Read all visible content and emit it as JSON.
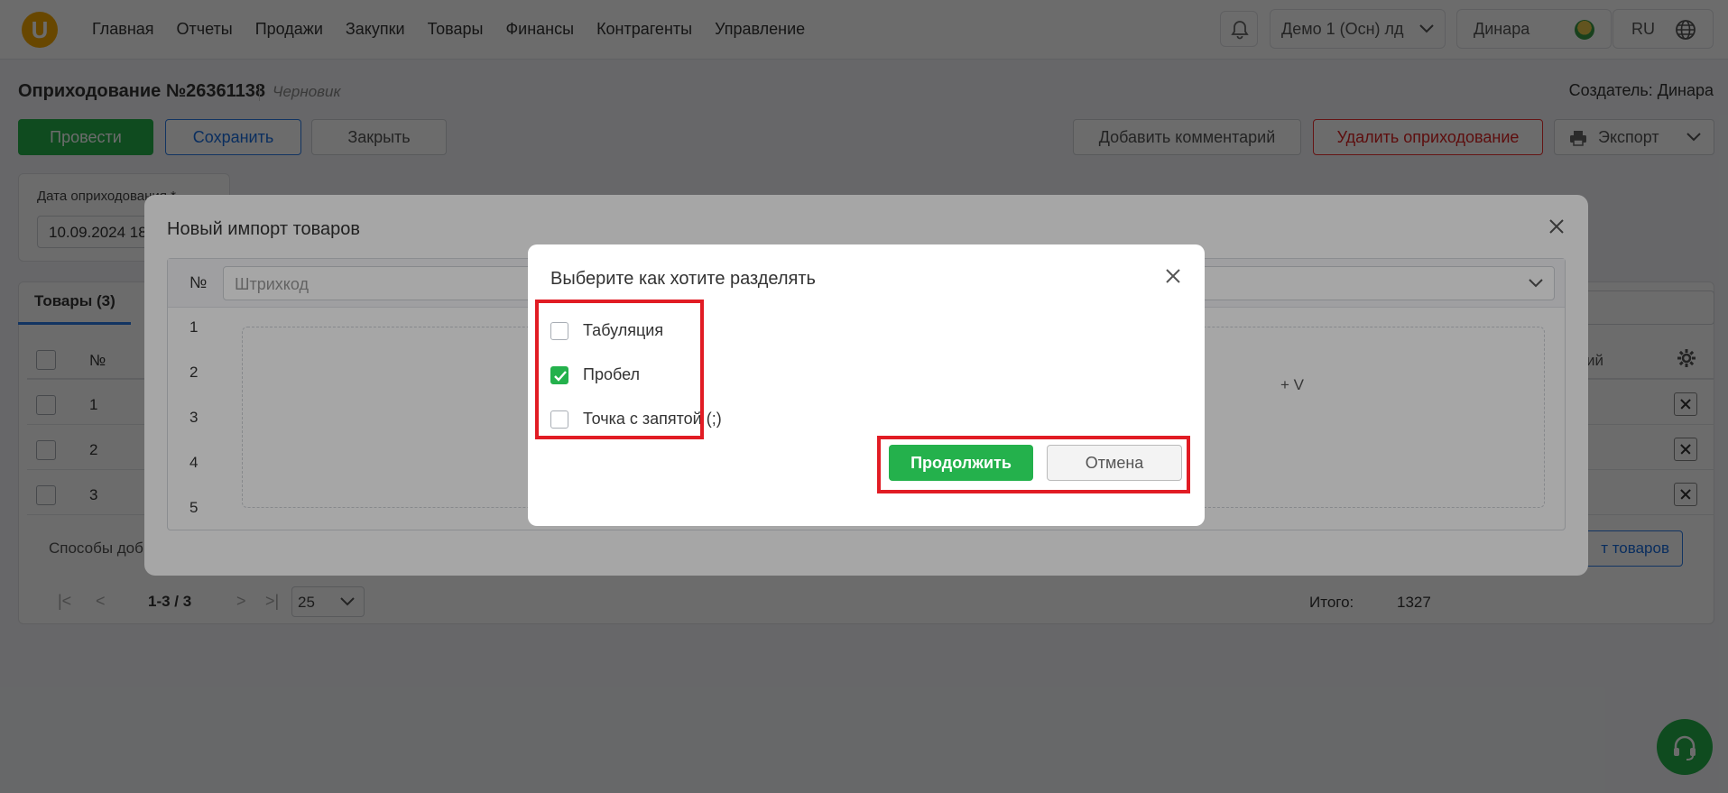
{
  "nav": {
    "logo": "U",
    "menu": [
      "Главная",
      "Отчеты",
      "Продажи",
      "Закупки",
      "Товары",
      "Финансы",
      "Контрагенты",
      "Управление"
    ],
    "org": "Демо 1 (Осн) лд",
    "user": "Динара",
    "lang": "RU"
  },
  "doc": {
    "title": "Оприходование №26361138",
    "status": "Черновик",
    "creator": "Создатель: Динара",
    "buttons": {
      "post": "Провести",
      "save": "Сохранить",
      "close": "Закрыть",
      "comment": "Добавить комментарий",
      "delete": "Удалить оприходование",
      "export": "Экспорт"
    },
    "date_label": "Дата оприходования *",
    "date_value": "10.09.2024 18",
    "tab": "Товары  (3)",
    "col_no": "№",
    "col_partial": "ий",
    "rows": [
      "1",
      "2",
      "3"
    ],
    "methods": "Способы доб",
    "import_btn": "т товаров",
    "pager_range": "1-3 / 3",
    "pager_size": "25",
    "total_label": "Итого:",
    "total_value": "1327"
  },
  "import_modal": {
    "title": "Новый импорт товаров",
    "col_no": "№",
    "column_select": "Штрихкод",
    "line_numbers": [
      "1",
      "2",
      "3",
      "4",
      "5"
    ],
    "hint": "+ V"
  },
  "split_dialog": {
    "title": "Выберите как хотите разделять",
    "options": [
      {
        "label": "Табуляция",
        "checked": false
      },
      {
        "label": "Пробел",
        "checked": true
      },
      {
        "label": "Точка с запятой (;)",
        "checked": false
      }
    ],
    "continue": "Продолжить",
    "cancel": "Отмена"
  },
  "colors": {
    "primary_green": "#24b14c",
    "primary_blue": "#2b7de9",
    "danger_red": "#e33",
    "highlight_red": "#e11c24"
  }
}
